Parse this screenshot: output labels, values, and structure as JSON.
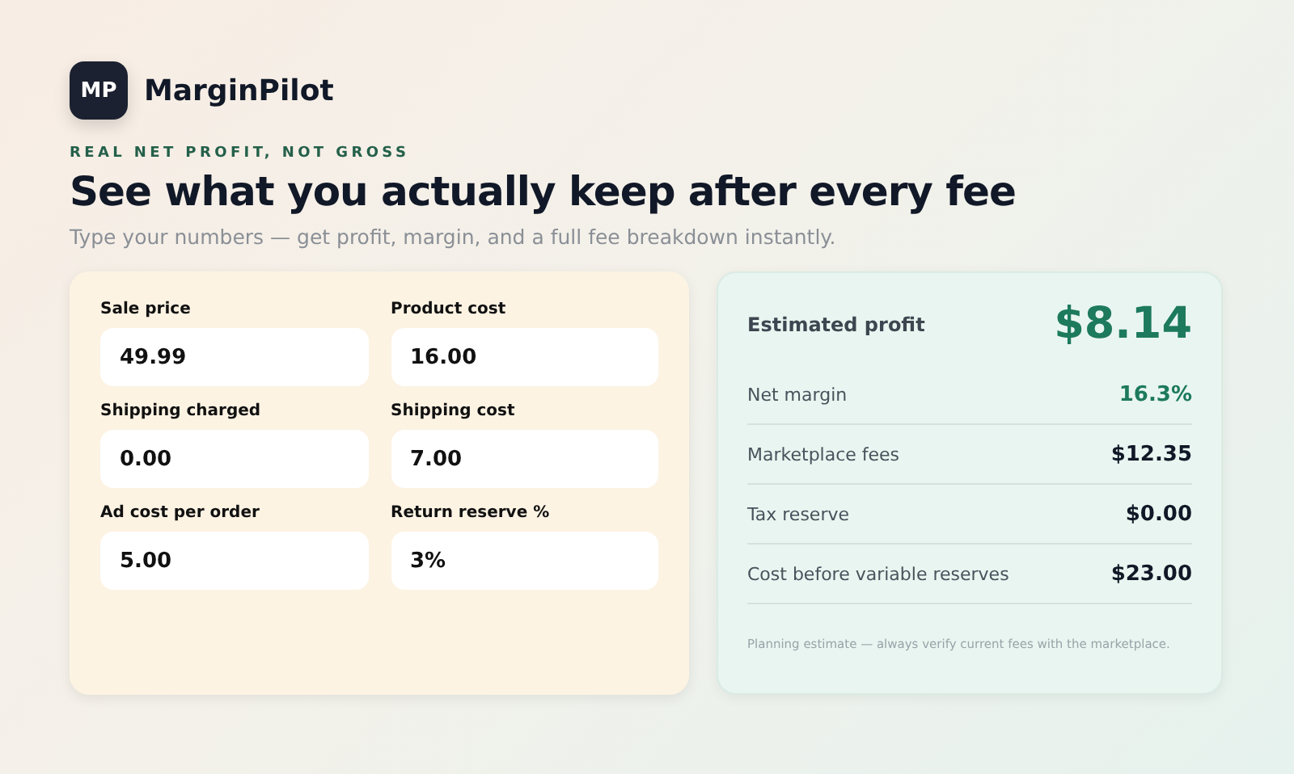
{
  "brand": {
    "logo": "MP",
    "name": "MarginPilot"
  },
  "eyebrow": "REAL NET PROFIT, NOT GROSS",
  "headline": "See what you actually keep after every fee",
  "subtitle": "Type your numbers — get profit, margin, and a full fee breakdown instantly.",
  "inputs": [
    {
      "label": "Sale price",
      "value": "49.99"
    },
    {
      "label": "Product cost",
      "value": "16.00"
    },
    {
      "label": "Shipping charged",
      "value": "0.00"
    },
    {
      "label": "Shipping cost",
      "value": "7.00"
    },
    {
      "label": "Ad cost per order",
      "value": "5.00"
    },
    {
      "label": "Return reserve %",
      "value": "3%"
    }
  ],
  "results": {
    "profit_label": "Estimated profit",
    "profit_value": "$8.14",
    "rows": [
      {
        "label": "Net margin",
        "value": "16.3%",
        "color": "#1d7a5c"
      },
      {
        "label": "Marketplace fees",
        "value": "$12.35",
        "color": "#111827"
      },
      {
        "label": "Tax reserve",
        "value": "$0.00",
        "color": "#111827"
      },
      {
        "label": "Cost before variable reserves",
        "value": "$23.00",
        "color": "#111827"
      }
    ],
    "note": "Planning estimate — always verify current fees with the marketplace."
  }
}
